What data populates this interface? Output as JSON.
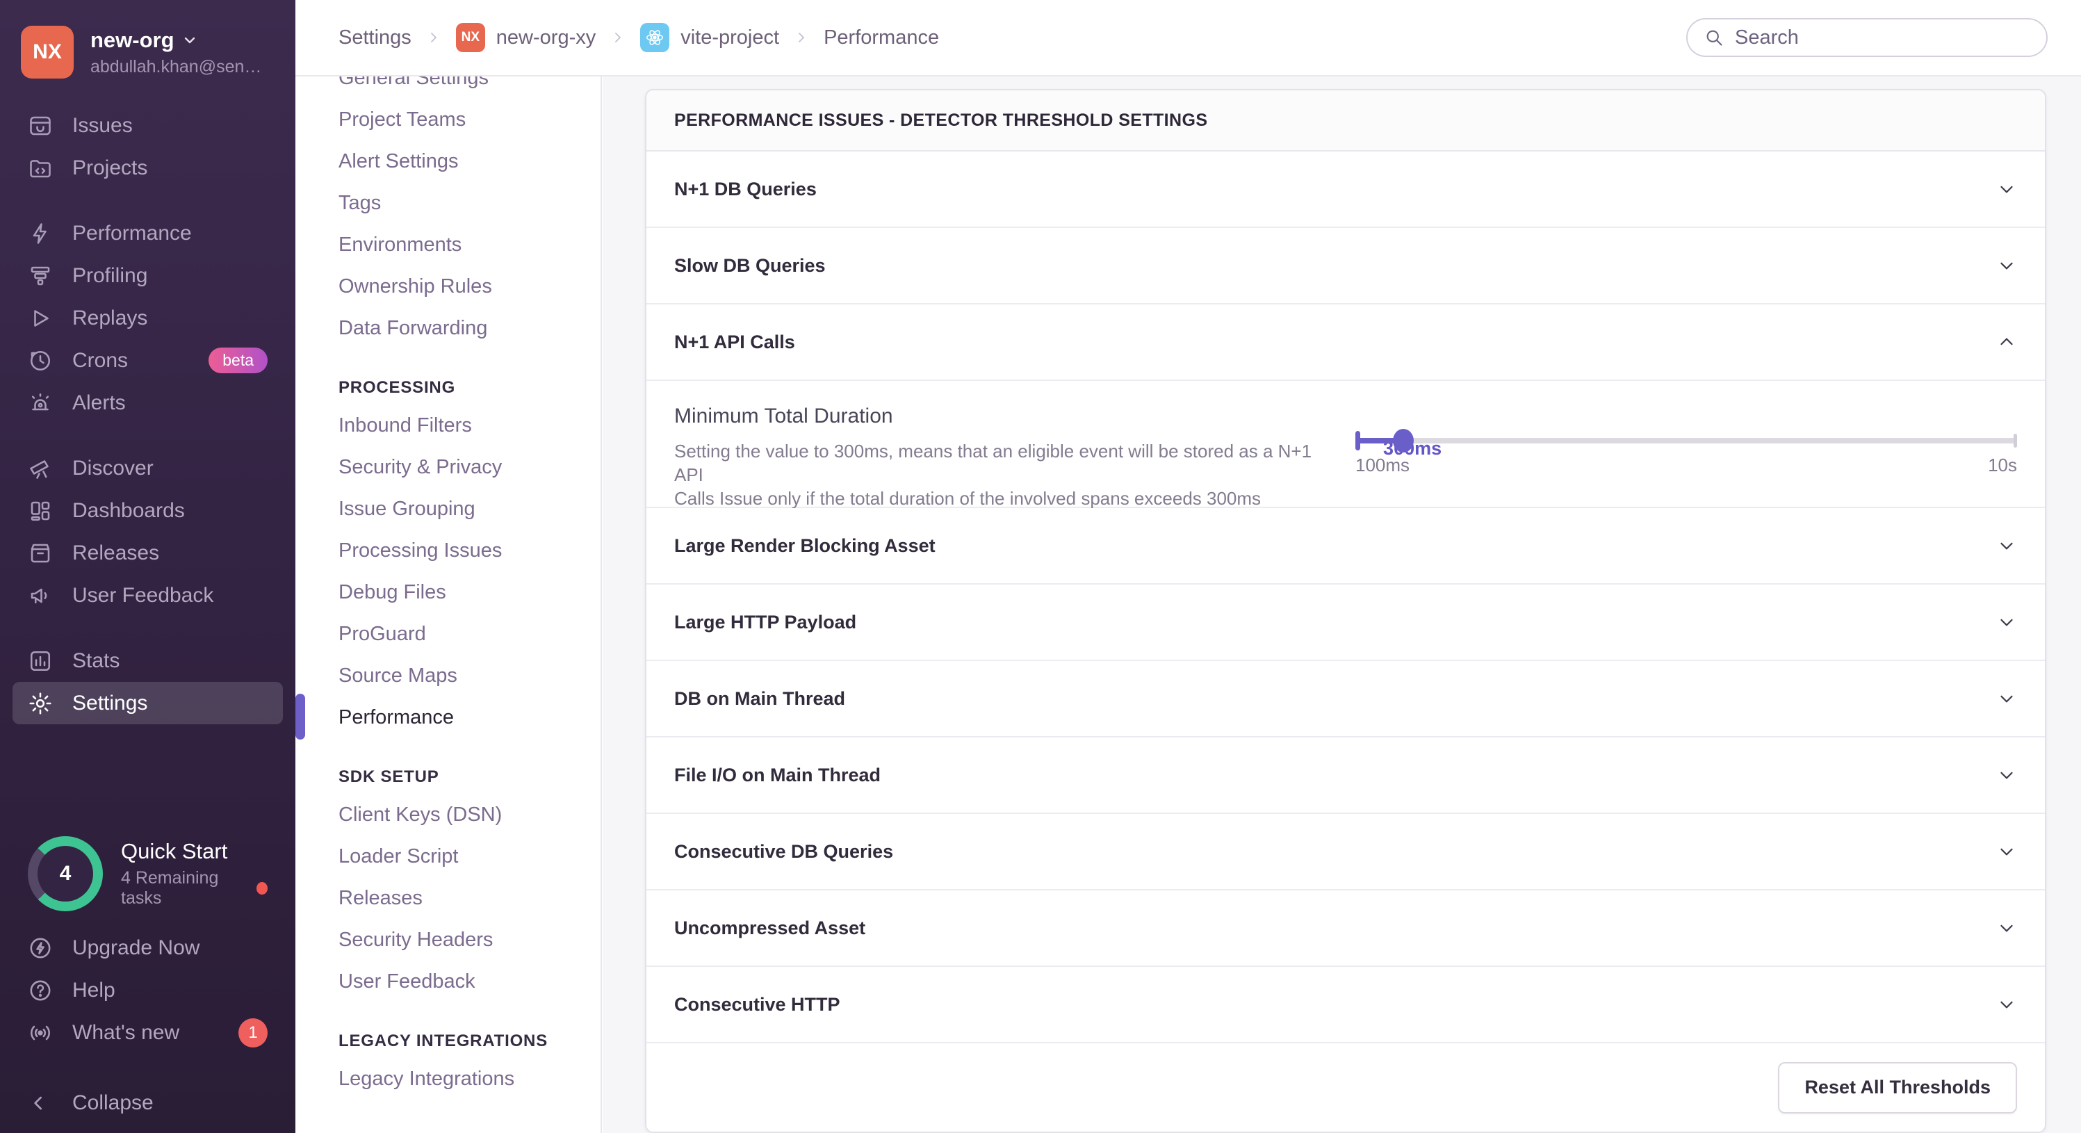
{
  "colors": {
    "accent": "#6C5FC7",
    "green": "#3EC492",
    "orange": "#E7684E",
    "react_blue": "#6EC9F2",
    "badge_red": "#EE5F5E"
  },
  "sidebar": {
    "org": {
      "initials": "NX",
      "name": "new-org",
      "email": "abdullah.khan@sen…"
    },
    "items": [
      {
        "label": "Issues"
      },
      {
        "label": "Projects"
      },
      {
        "label": "Performance"
      },
      {
        "label": "Profiling"
      },
      {
        "label": "Replays"
      },
      {
        "label": "Crons",
        "badge": "beta"
      },
      {
        "label": "Alerts"
      },
      {
        "label": "Discover"
      },
      {
        "label": "Dashboards"
      },
      {
        "label": "Releases"
      },
      {
        "label": "User Feedback"
      },
      {
        "label": "Stats"
      },
      {
        "label": "Settings"
      }
    ],
    "quickstart": {
      "title": "Quick Start",
      "subtitle": "4 Remaining tasks",
      "count": "4",
      "percent": 76
    },
    "footer_items": [
      {
        "label": "Upgrade Now"
      },
      {
        "label": "Help"
      },
      {
        "label": "What's new",
        "badge": "1"
      }
    ],
    "collapse_label": "Collapse"
  },
  "settings_nav": {
    "sections": [
      {
        "heading": "",
        "items": [
          {
            "label": "General Settings"
          },
          {
            "label": "Project Teams"
          },
          {
            "label": "Alert Settings"
          },
          {
            "label": "Tags"
          },
          {
            "label": "Environments"
          },
          {
            "label": "Ownership Rules"
          },
          {
            "label": "Data Forwarding"
          }
        ]
      },
      {
        "heading": "PROCESSING",
        "items": [
          {
            "label": "Inbound Filters"
          },
          {
            "label": "Security & Privacy"
          },
          {
            "label": "Issue Grouping"
          },
          {
            "label": "Processing Issues"
          },
          {
            "label": "Debug Files"
          },
          {
            "label": "ProGuard"
          },
          {
            "label": "Source Maps"
          },
          {
            "label": "Performance",
            "active": true
          }
        ]
      },
      {
        "heading": "SDK SETUP",
        "items": [
          {
            "label": "Client Keys (DSN)"
          },
          {
            "label": "Loader Script"
          },
          {
            "label": "Releases"
          },
          {
            "label": "Security Headers"
          },
          {
            "label": "User Feedback"
          }
        ]
      },
      {
        "heading": "LEGACY INTEGRATIONS",
        "items": [
          {
            "label": "Legacy Integrations"
          }
        ]
      }
    ]
  },
  "topbar": {
    "breadcrumb": {
      "settings": "Settings",
      "org": "new-org-xy",
      "org_badge": "NX",
      "project": "vite-project",
      "page": "Performance"
    },
    "search_placeholder": "Search"
  },
  "panel": {
    "title": "PERFORMANCE ISSUES - DETECTOR THRESHOLD SETTINGS",
    "rows": [
      {
        "label": "N+1 DB Queries",
        "expanded": false
      },
      {
        "label": "Slow DB Queries",
        "expanded": false
      },
      {
        "label": "N+1 API Calls",
        "expanded": true
      },
      {
        "label": "Large Render Blocking Asset",
        "expanded": false
      },
      {
        "label": "Large HTTP Payload",
        "expanded": false
      },
      {
        "label": "DB on Main Thread",
        "expanded": false
      },
      {
        "label": "File I/O on Main Thread",
        "expanded": false
      },
      {
        "label": "Consecutive DB Queries",
        "expanded": false
      },
      {
        "label": "Uncompressed Asset",
        "expanded": false
      },
      {
        "label": "Consecutive HTTP",
        "expanded": false
      }
    ],
    "detail": {
      "title": "Minimum Total Duration",
      "description_line1": "Setting the value to 300ms, means that an eligible event will be stored as a N+1 API",
      "description_line2": "Calls Issue only if the total duration of the involved spans exceeds 300ms",
      "slider": {
        "value": "300ms",
        "min": "100ms",
        "max": "10s",
        "percent": 7.3
      }
    },
    "footer": {
      "reset_label": "Reset All Thresholds"
    }
  }
}
